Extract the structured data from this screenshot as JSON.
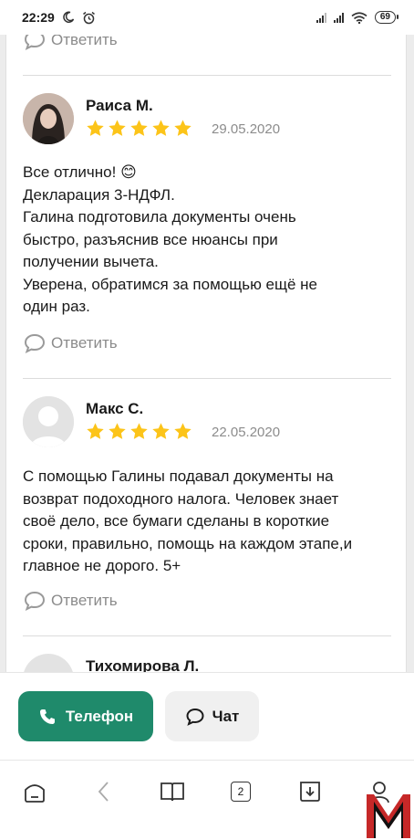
{
  "status": {
    "time": "22:29",
    "battery": "69"
  },
  "reply_label": "Ответить",
  "reviews": [
    {
      "author": "Раиса М.",
      "rating": 5,
      "date": "29.05.2020",
      "lines": [
        "Все отлично! 😊",
        "Декларация 3-НДФЛ.",
        "Галина подготовила документы очень",
        "быстро, разъяснив все нюансы при",
        "получении вычета.",
        "Уверена, обратимся за помощью ещё не",
        "один раз."
      ]
    },
    {
      "author": "Макс С.",
      "rating": 5,
      "date": "22.05.2020",
      "lines": [
        "С помощью Галины подавал документы на",
        "возврат подоходного налога. Человек знает",
        "своё дело, все бумаги сделаны в короткие",
        "сроки, правильно, помощь на каждом этапе,и",
        "главное не дорого. 5+"
      ]
    },
    {
      "author": "Тихомирова Л."
    }
  ],
  "actions": {
    "phone": "Телефон",
    "chat": "Чат"
  },
  "browser_nav": {
    "tabs_count": "2"
  },
  "colors": {
    "accent": "#1f8a6b",
    "star": "#fcc419",
    "muted": "#8c8c8c"
  },
  "icons": [
    "moon-icon",
    "alarm-icon",
    "signal-icon",
    "wifi-icon",
    "battery-icon",
    "comment-icon",
    "star-icon",
    "phone-icon",
    "chat-icon",
    "home-icon",
    "back-icon",
    "book-icon",
    "tabs-icon",
    "download-icon",
    "profile-icon"
  ]
}
